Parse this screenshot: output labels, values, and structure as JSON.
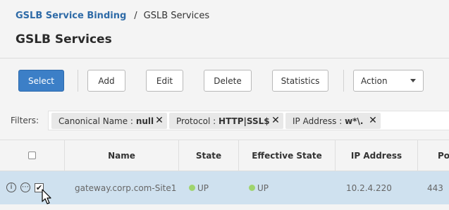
{
  "breadcrumb": {
    "parent": "GSLB Service Binding",
    "separator": "/",
    "current": "GSLB Services"
  },
  "page_title": "GSLB Services",
  "toolbar": {
    "select_label": "Select",
    "add_label": "Add",
    "edit_label": "Edit",
    "delete_label": "Delete",
    "statistics_label": "Statistics",
    "action_label": "Action"
  },
  "filters": {
    "label": "Filters:",
    "chips": [
      {
        "key": "Canonical Name :",
        "value": "null",
        "remove": "✕"
      },
      {
        "key": "Protocol :",
        "value": "HTTP|SSL$",
        "remove": "✕"
      },
      {
        "key": "IP Address :",
        "value": "w*\\.",
        "remove": "✕"
      }
    ]
  },
  "table": {
    "columns": [
      "Name",
      "State",
      "Effective State",
      "IP Address",
      "Port"
    ],
    "rows": [
      {
        "name": "gateway.corp.com-Site1",
        "state": "UP",
        "effective_state": "UP",
        "ip_address": "10.2.4.220",
        "port": "443",
        "selected": true
      }
    ]
  },
  "colors": {
    "primary": "#3c7fc7",
    "link": "#2f6ba7",
    "row_selected": "#cfe1ef",
    "status_up": "#9fd46e"
  },
  "icons": {
    "info": "i",
    "more": "⋯",
    "check": "✔"
  }
}
